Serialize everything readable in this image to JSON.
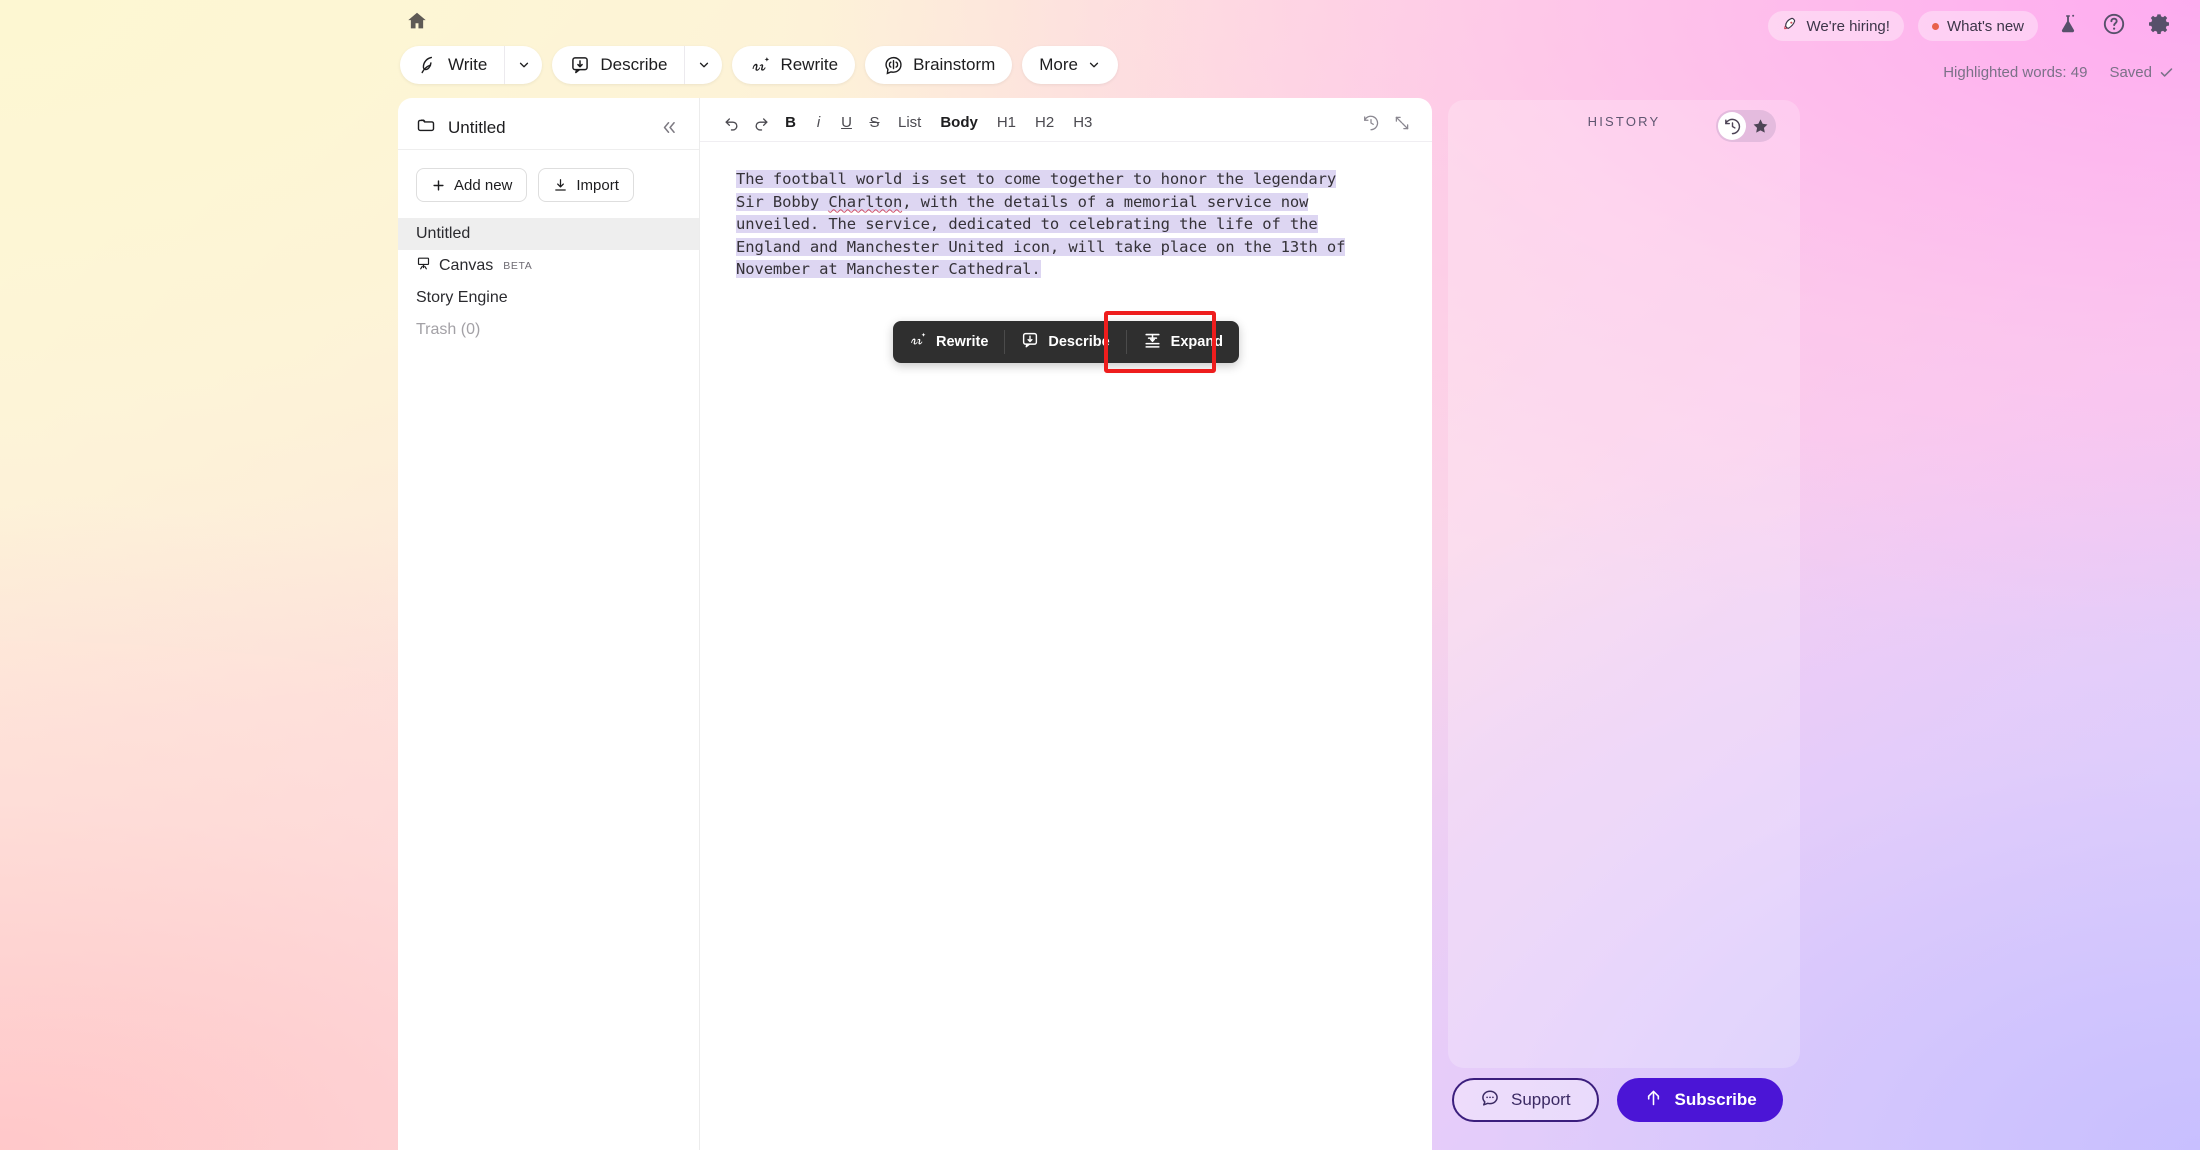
{
  "topbar": {
    "home_icon": "home-icon",
    "groups": [
      {
        "label": "Write",
        "icon": "quill-pen-icon",
        "has_caret": true
      },
      {
        "label": "Describe",
        "icon": "describe-card-icon",
        "has_caret": true
      },
      {
        "label": "Rewrite",
        "icon": "ai-sparkle-icon",
        "has_caret": false
      },
      {
        "label": "Brainstorm",
        "icon": "brain-icon",
        "has_caret": false
      },
      {
        "label": "More",
        "icon": "",
        "has_caret": true
      }
    ]
  },
  "topright": {
    "hiring_label": "We're hiring!",
    "hiring_icon": "rocket-icon",
    "whats_new_label": "What's new",
    "whats_new_dot_color": "#e8604c",
    "flask_icon": "flask-icon",
    "help_icon": "question-circle-icon",
    "settings_icon": "gear-icon",
    "highlighted_words": "Highlighted words: 49",
    "saved_label": "Saved",
    "saved_icon": "check-icon"
  },
  "sidebar": {
    "folder_icon": "folder-icon",
    "title": "Untitled",
    "collapse_icon": "chevrons-left-icon",
    "actions": [
      {
        "label": "Add new",
        "icon": "plus-icon"
      },
      {
        "label": "Import",
        "icon": "download-icon"
      }
    ],
    "items": [
      {
        "label": "Untitled",
        "icon": "",
        "badge": "",
        "active": true,
        "muted": false
      },
      {
        "label": "Canvas",
        "icon": "easel-icon",
        "badge": "BETA",
        "active": false,
        "muted": false
      },
      {
        "label": "Story Engine",
        "icon": "",
        "badge": "",
        "active": false,
        "muted": false
      },
      {
        "label": "Trash (0)",
        "icon": "",
        "badge": "",
        "active": false,
        "muted": true
      }
    ]
  },
  "editor": {
    "toolbar": [
      {
        "name": "undo",
        "label": "undo-icon",
        "kind": "icon"
      },
      {
        "name": "redo",
        "label": "redo-icon",
        "kind": "icon"
      },
      {
        "name": "bold",
        "label": "B",
        "kind": "strong"
      },
      {
        "name": "italic",
        "label": "i",
        "kind": "ital"
      },
      {
        "name": "underline",
        "label": "U",
        "kind": "und"
      },
      {
        "name": "strikethrough",
        "label": "S",
        "kind": "strike"
      },
      {
        "name": "list",
        "label": "List",
        "kind": "wide"
      },
      {
        "name": "body",
        "label": "Body",
        "kind": "strong wide"
      },
      {
        "name": "h1",
        "label": "H1",
        "kind": "wide"
      },
      {
        "name": "h2",
        "label": "H2",
        "kind": "wide"
      },
      {
        "name": "h3",
        "label": "H3",
        "kind": "wide"
      }
    ],
    "history_icon": "clock-history-icon",
    "fullscreen_icon": "diagonal-resize-icon",
    "document": {
      "text_part_1": "The football world is set to come together to honor the legendary Sir Bobby ",
      "misspelled_word": "Charlton",
      "text_part_2": ", with the details of a memorial service now unveiled. The service, dedicated to celebrating the life of the England and Manchester United icon, will take place on the 13th of November at Manchester Cathedral.",
      "highlight_color": "#ddd6f2"
    }
  },
  "ai_toolbar": {
    "buttons": [
      {
        "label": "Rewrite",
        "icon": "ai-sparkle-icon"
      },
      {
        "label": "Describe",
        "icon": "describe-card-icon"
      },
      {
        "label": "Expand",
        "icon": "expand-lines-icon"
      }
    ],
    "highlighted_button": "Expand",
    "highlight_border_color": "#ee1d1d"
  },
  "history_panel": {
    "label": "HISTORY",
    "toggle": [
      {
        "icon": "clock-history-icon",
        "selected": true
      },
      {
        "icon": "star-icon",
        "selected": false
      }
    ]
  },
  "bottom_actions": {
    "support_label": "Support",
    "support_icon": "chat-bubble-icon",
    "subscribe_label": "Subscribe",
    "subscribe_icon": "up-arrow-icon",
    "subscribe_color": "#4b15d6"
  }
}
